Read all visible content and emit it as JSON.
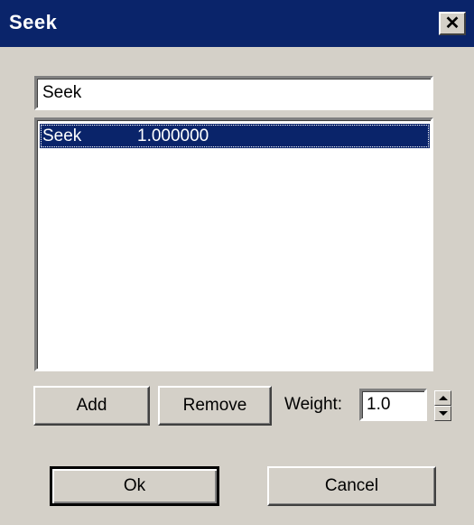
{
  "window": {
    "title": "Seek",
    "close_glyph": "✕"
  },
  "name_input": {
    "value": "Seek"
  },
  "list": {
    "items": [
      {
        "name": "Seek",
        "weight": "1.000000",
        "selected": true
      }
    ]
  },
  "buttons": {
    "add_label": "Add",
    "remove_label": "Remove",
    "ok_label": "Ok",
    "cancel_label": "Cancel"
  },
  "weight": {
    "label": "Weight:",
    "value": "1.0"
  },
  "colors": {
    "titlebar": "#0a246a",
    "face": "#d4d0c8",
    "selection": "#0a246a"
  }
}
